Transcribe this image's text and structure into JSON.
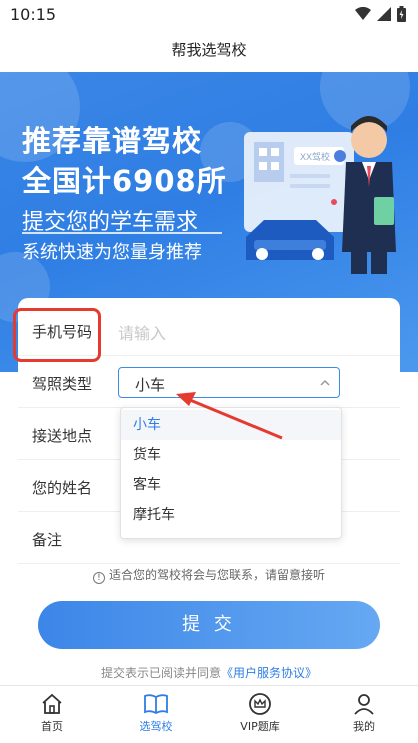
{
  "status_bar": {
    "time": "10:15"
  },
  "header": {
    "title": "帮我选驾校"
  },
  "hero": {
    "line1": "推荐靠谱驾校",
    "line2": "全国计6908所",
    "line3": "提交您的学车需求",
    "line4": "系统快速为您量身推荐",
    "sign_text": "XX驾校"
  },
  "form": {
    "phone_label": "手机号码",
    "phone_placeholder": "请输入",
    "license_label": "驾照类型",
    "license_value": "小车",
    "pickup_label": "接送地点",
    "name_label": "您的姓名",
    "note_label": "备注",
    "license_options": [
      "小车",
      "货车",
      "客车",
      "摩托车"
    ],
    "notice": "适合您的驾校将会与您联系，请留意接听",
    "submit_label": "提 交",
    "agree_prefix": "提交表示已阅读并同意",
    "agree_link": "《用户服务协议》"
  },
  "tabbar": {
    "items": [
      {
        "label": "首页",
        "icon": "home-icon"
      },
      {
        "label": "选驾校",
        "icon": "book-icon"
      },
      {
        "label": "VIP题库",
        "icon": "crown-icon"
      },
      {
        "label": "我的",
        "icon": "person-icon"
      }
    ],
    "active_index": 1
  },
  "colors": {
    "primary": "#2f7ee4",
    "highlight": "#e43a2f"
  }
}
